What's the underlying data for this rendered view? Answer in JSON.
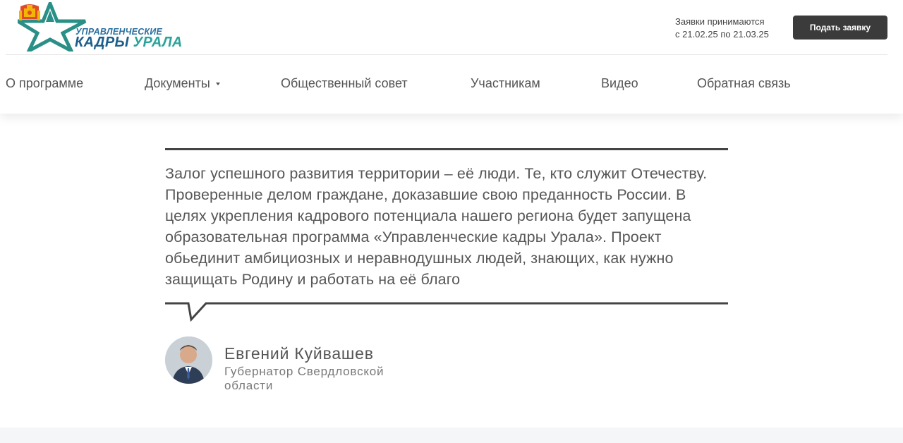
{
  "logo": {
    "line1": "УПРАВЛЕНЧЕСКИЕ",
    "line2_part1": "КАДРЫ",
    "line2_part2": "УРАЛА",
    "star_color": "#2a8f86",
    "text_color": "#1b5e8c",
    "accent_color": "#2aa39a"
  },
  "apply": {
    "info_line1": "Заявки принимаются",
    "info_line2": "с 21.02.25 по 21.03.25",
    "button_label": "Подать заявку"
  },
  "nav": {
    "items": [
      {
        "label": "О программе"
      },
      {
        "label": "Документы",
        "has_dropdown": true
      },
      {
        "label": "Общественный совет"
      },
      {
        "label": "Участникам"
      },
      {
        "label": "Видео"
      },
      {
        "label": "Обратная связь"
      }
    ]
  },
  "quote": {
    "text": "Залог успешного развития территории – её люди. Те, кто служит Отечеству. Проверенные делом граждане, доказавшие свою преданность России. В целях укрепления кадрового потенциала нашего региона будет запущена образовательная программа «Управленческие кадры Урала». Проект обьединит амбициозных и неравнодушных людей, знающих, как нужно защищать Родину и работать на её благо"
  },
  "author": {
    "name": "Евгений Куйвашев",
    "role": "Губернатор Свердловской области"
  }
}
